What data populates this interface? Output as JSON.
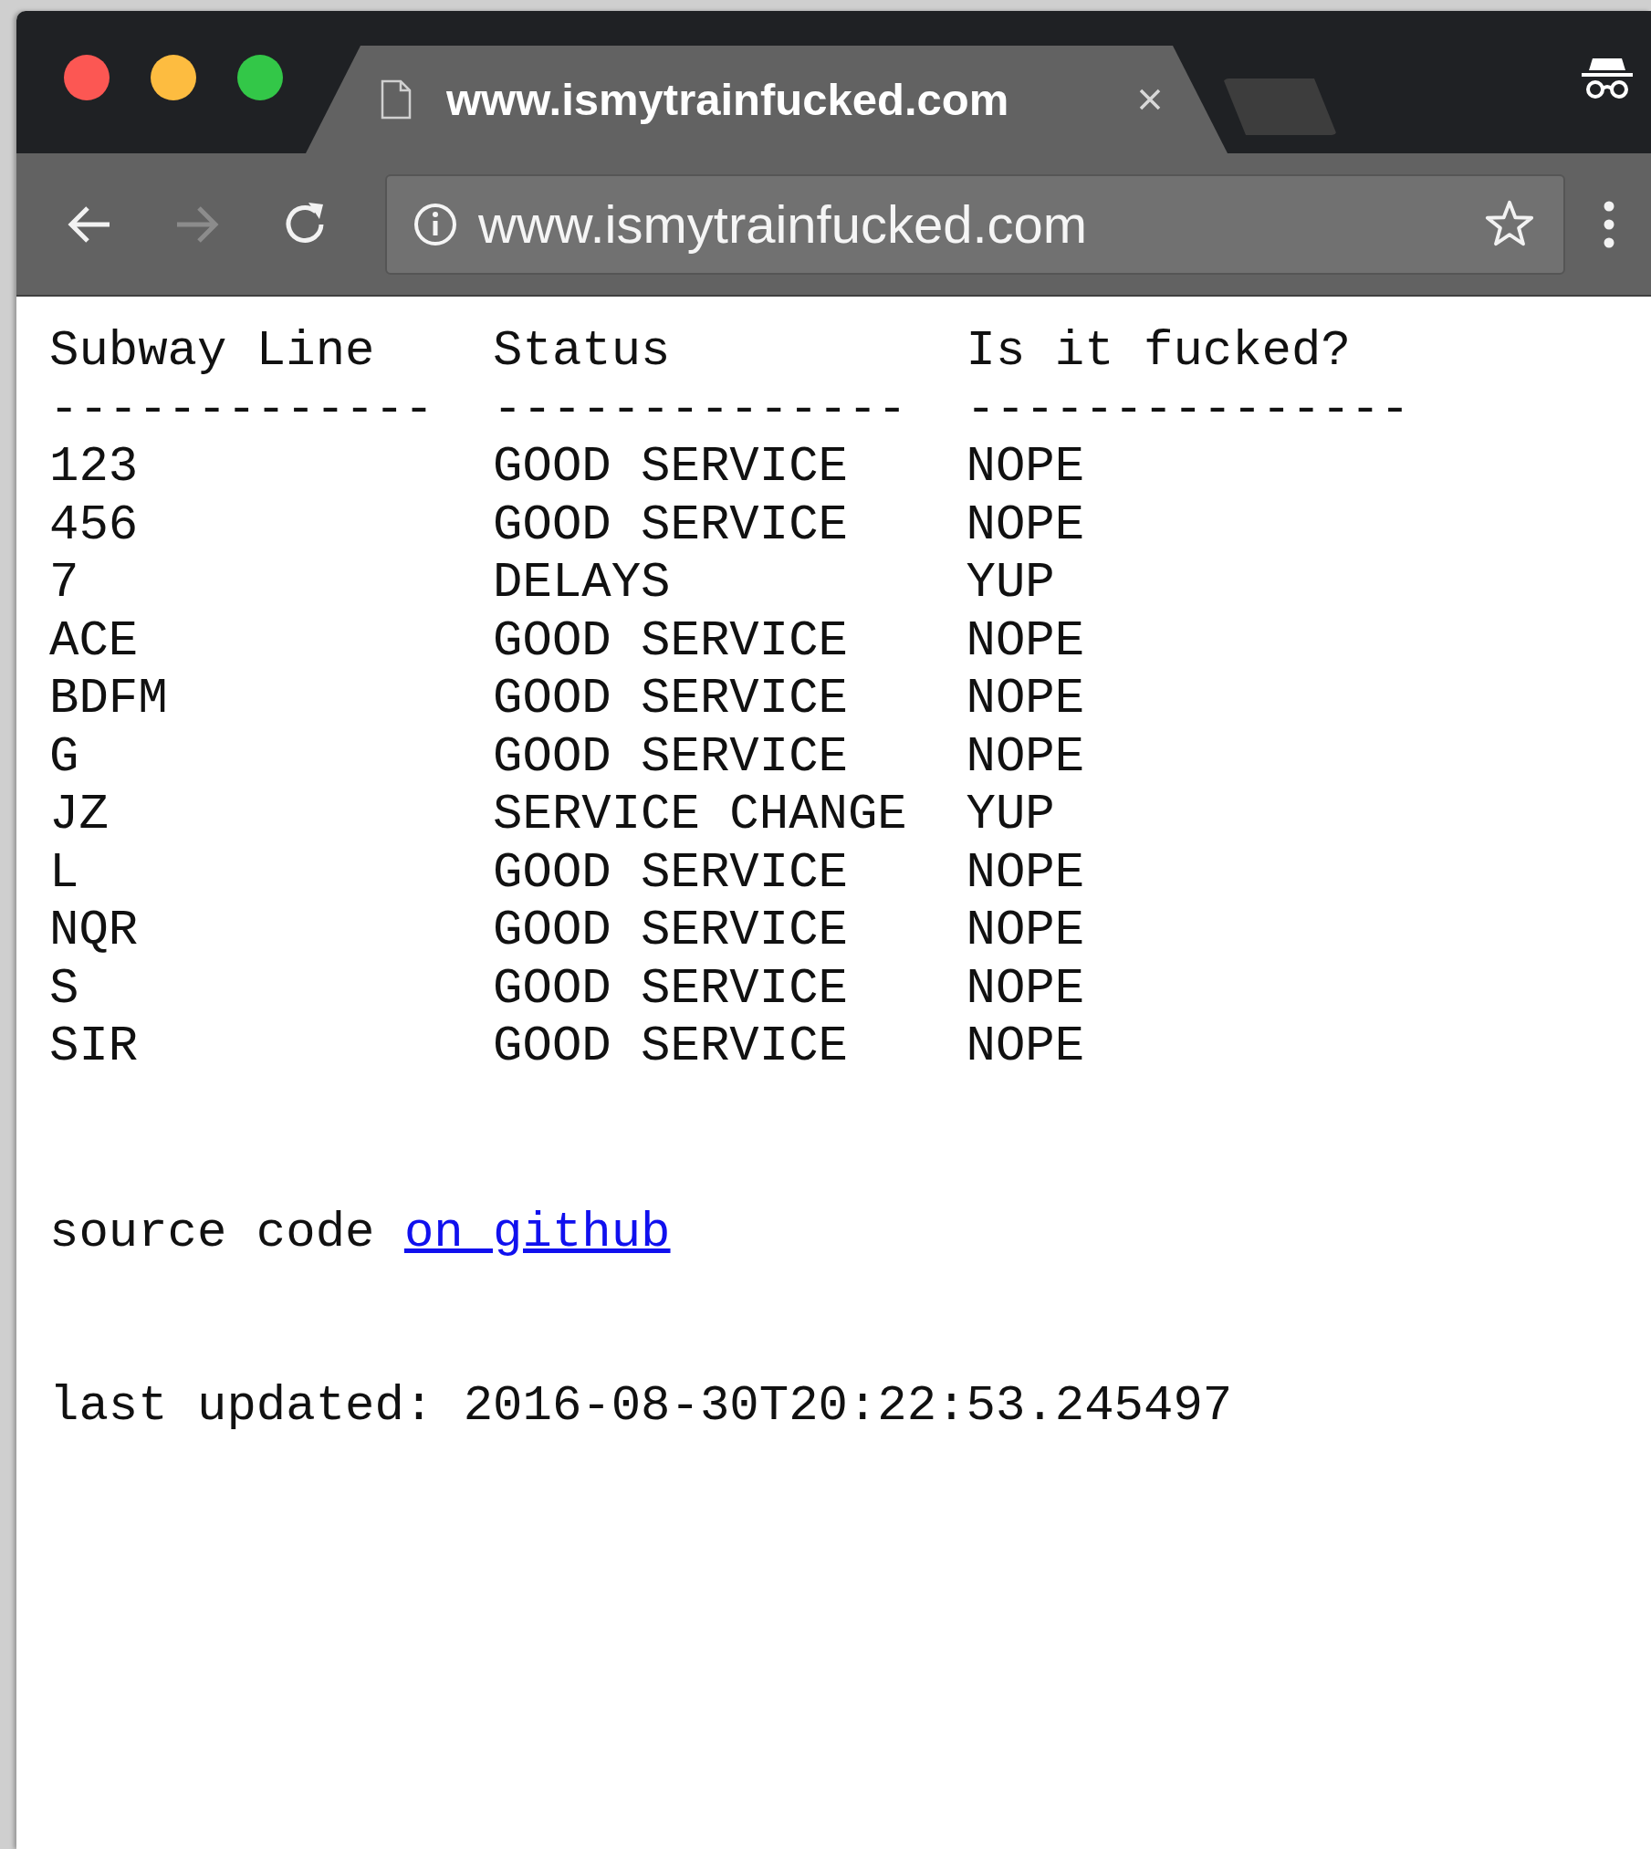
{
  "browser": {
    "tabs": [
      {
        "title": "www.ismytrainfucked.com",
        "selected": true
      }
    ],
    "address_bar": {
      "url": "www.ismytrainfucked.com"
    }
  },
  "page": {
    "columns": [
      "Subway Line",
      "Status",
      "Is it fucked?"
    ],
    "rules": [
      "-------------",
      "--------------",
      "---------------"
    ],
    "rows": [
      {
        "line": "123",
        "status": "GOOD SERVICE",
        "fucked": "NOPE"
      },
      {
        "line": "456",
        "status": "GOOD SERVICE",
        "fucked": "NOPE"
      },
      {
        "line": "7",
        "status": "DELAYS",
        "fucked": "YUP"
      },
      {
        "line": "ACE",
        "status": "GOOD SERVICE",
        "fucked": "NOPE"
      },
      {
        "line": "BDFM",
        "status": "GOOD SERVICE",
        "fucked": "NOPE"
      },
      {
        "line": "G",
        "status": "GOOD SERVICE",
        "fucked": "NOPE"
      },
      {
        "line": "JZ",
        "status": "SERVICE CHANGE",
        "fucked": "YUP"
      },
      {
        "line": "L",
        "status": "GOOD SERVICE",
        "fucked": "NOPE"
      },
      {
        "line": "NQR",
        "status": "GOOD SERVICE",
        "fucked": "NOPE"
      },
      {
        "line": "S",
        "status": "GOOD SERVICE",
        "fucked": "NOPE"
      },
      {
        "line": "SIR",
        "status": "GOOD SERVICE",
        "fucked": "NOPE"
      }
    ],
    "source": {
      "text": "source code",
      "link": "on github"
    },
    "last_updated": "last updated: 2016-08-30T20:22:53.245497"
  }
}
